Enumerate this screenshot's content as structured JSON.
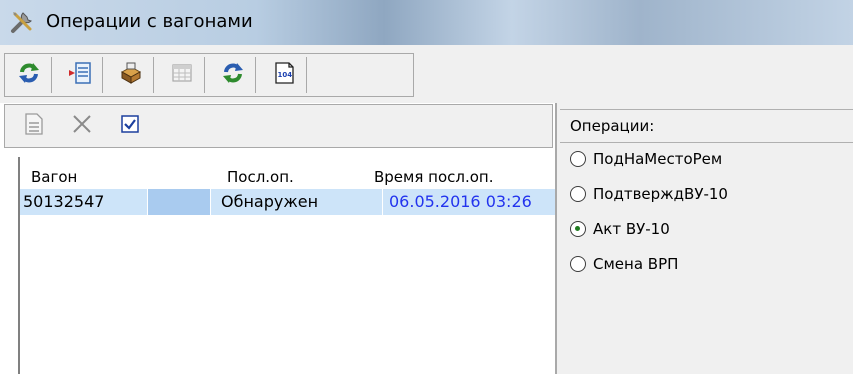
{
  "window": {
    "title": "Операции с вагонами",
    "app_icon": "tools-icon"
  },
  "toolbar": {
    "buttons": [
      {
        "icon": "refresh-icon",
        "enabled": true
      },
      {
        "icon": "import-list-icon",
        "enabled": true
      },
      {
        "icon": "print-stack-icon",
        "enabled": true
      },
      {
        "icon": "grid-table-icon",
        "enabled": false
      },
      {
        "icon": "refresh-alt-icon",
        "enabled": true
      },
      {
        "icon": "form-104-icon",
        "enabled": true,
        "label": "104"
      }
    ]
  },
  "sub_toolbar": {
    "buttons": [
      {
        "icon": "document-icon",
        "enabled": false
      },
      {
        "icon": "delete-icon",
        "enabled": false
      },
      {
        "icon": "checkbox-icon",
        "enabled": true
      }
    ]
  },
  "grid": {
    "columns": [
      "Вагон",
      "",
      "Посл.оп.",
      "Время посл.оп."
    ],
    "rows": [
      {
        "wagon": "50132547",
        "extra": "",
        "last_op": "Обнаружен",
        "last_op_time": "06.05.2016 03:26"
      }
    ]
  },
  "operations": {
    "header": "Операции:",
    "options": [
      {
        "label": "ПодНаМестоРем",
        "selected": false
      },
      {
        "label": "ПодтверждВУ-10",
        "selected": false
      },
      {
        "label": "Акт ВУ-10",
        "selected": true
      },
      {
        "label": "Смена ВРП",
        "selected": false
      }
    ]
  }
}
